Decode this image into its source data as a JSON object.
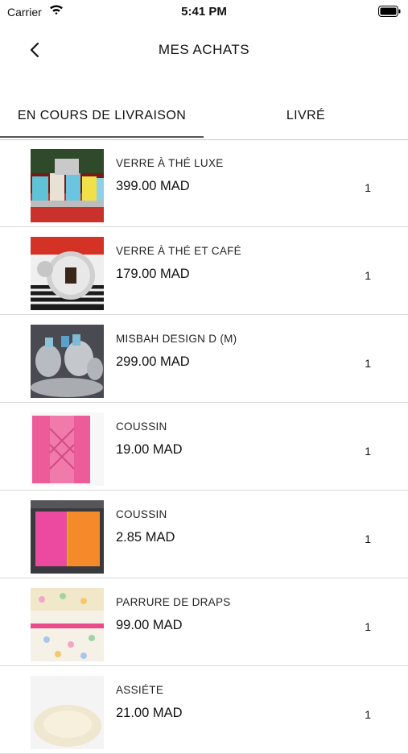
{
  "status": {
    "carrier": "Carrier",
    "time": "5:41 PM"
  },
  "nav": {
    "title": "MES ACHATS"
  },
  "tabs": [
    {
      "label": "EN COURS DE LIVRAISON",
      "active": true
    },
    {
      "label": "LIVRÉ",
      "active": false
    }
  ],
  "orders": [
    {
      "name": "VERRE À THÉ LUXE",
      "price": "399.00 MAD",
      "qty": "1",
      "thumbnail": "colorful-tea-glasses"
    },
    {
      "name": "VERRE À THÉ ET CAFÉ",
      "price": "179.00 MAD",
      "qty": "1",
      "thumbnail": "tea-coffee-tray"
    },
    {
      "name": "MISBAH DESIGN D (M)",
      "price": "299.00 MAD",
      "qty": "1",
      "thumbnail": "silver-teapots"
    },
    {
      "name": "COUSSIN",
      "price": "19.00 MAD",
      "qty": "1",
      "thumbnail": "pink-cushion"
    },
    {
      "name": "COUSSIN",
      "price": "2.85 MAD",
      "qty": "1",
      "thumbnail": "pink-orange-cushion"
    },
    {
      "name": "PARRURE DE DRAPS",
      "price": "99.00 MAD",
      "qty": "1",
      "thumbnail": "bed-sheets"
    },
    {
      "name": "ASSIÉTE",
      "price": "21.00 MAD",
      "qty": "1",
      "thumbnail": "plate"
    }
  ],
  "colors": {
    "indicator": "#555555",
    "divider": "#d9d9d9"
  }
}
